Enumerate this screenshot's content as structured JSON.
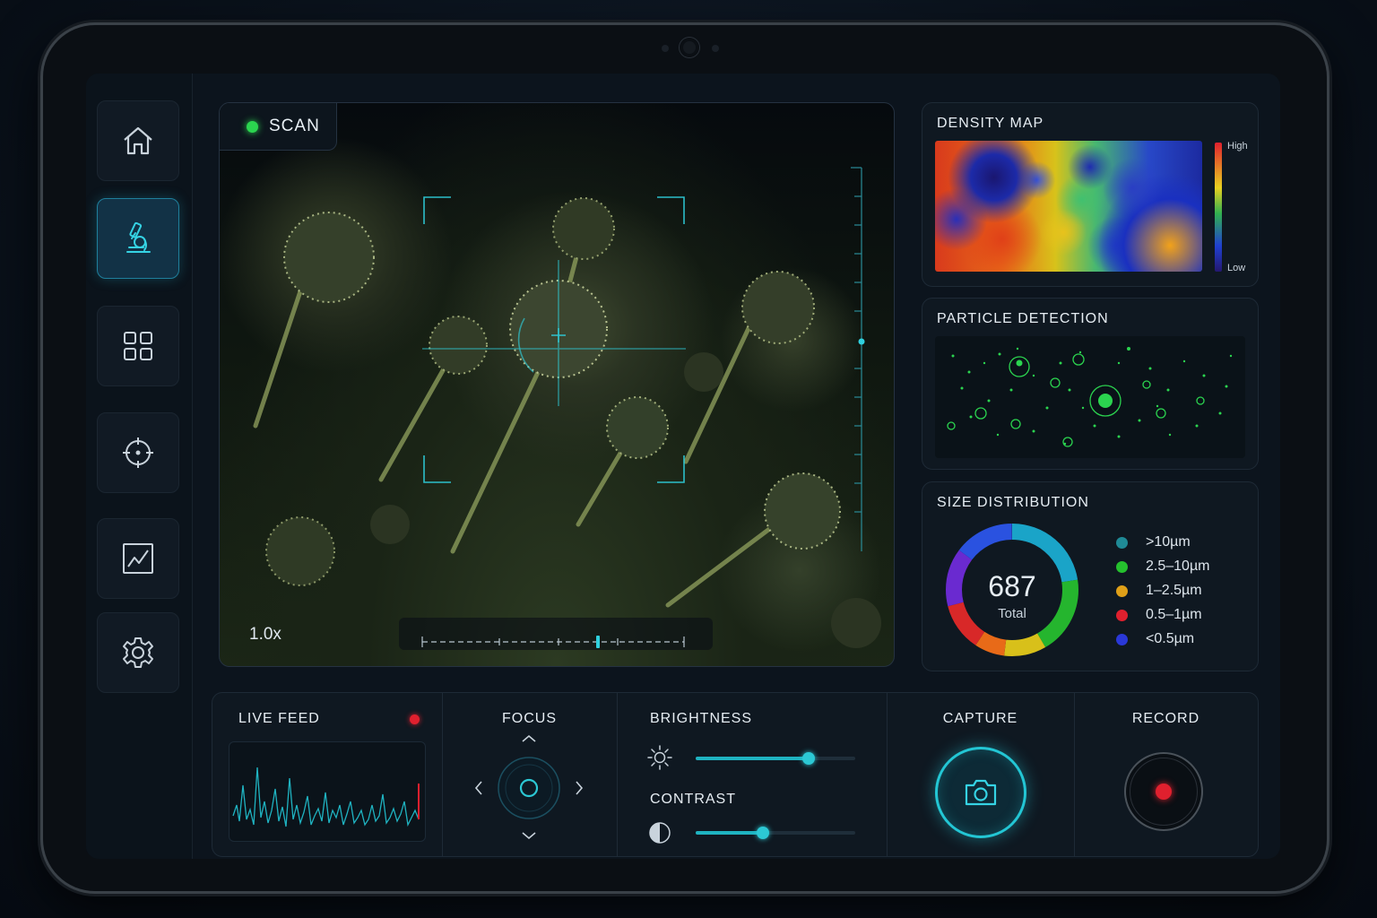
{
  "viewer": {
    "scan_label": "SCAN",
    "zoom_label": "1.0x"
  },
  "density_map": {
    "title": "DENSITY MAP",
    "scale_high": "High",
    "scale_low": "Low"
  },
  "particle_detection": {
    "title": "PARTICLE DETECTION"
  },
  "size_distribution": {
    "title": "SIZE DISTRIBUTION",
    "total_value": "687",
    "total_label": "Total",
    "legend": [
      {
        "label": ">10µm",
        "color": "#1f8a96"
      },
      {
        "label": "2.5–10µm",
        "color": "#25c02e"
      },
      {
        "label": "1–2.5µm",
        "color": "#e0a018"
      },
      {
        "label": "0.5–1µm",
        "color": "#e0202e"
      },
      {
        "label": "<0.5µm",
        "color": "#2a38d8"
      }
    ]
  },
  "controls": {
    "live_feed_title": "LIVE FEED",
    "focus_title": "FOCUS",
    "brightness_title": "BRIGHTNESS",
    "contrast_title": "CONTRAST",
    "capture_title": "CAPTURE",
    "record_title": "RECORD",
    "brightness_level": 0.71,
    "contrast_level": 0.42
  },
  "colors": {
    "accent": "#1fb3c1",
    "live": "#e0202e",
    "scan": "#2bd44f"
  }
}
